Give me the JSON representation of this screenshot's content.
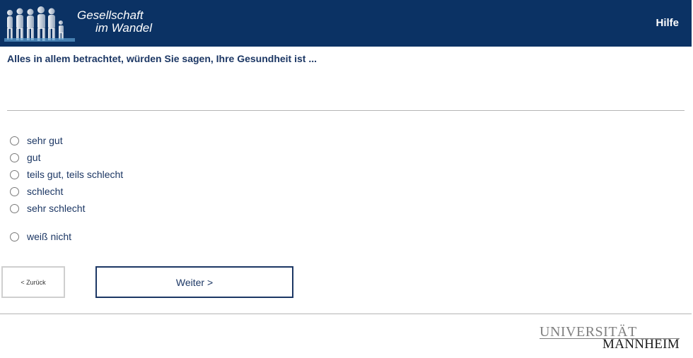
{
  "header": {
    "logo_line1": "Gesellschaft",
    "logo_line2": "im Wandel",
    "help_label": "Hilfe"
  },
  "question": {
    "text": "Alles in allem betrachtet, würden Sie sagen, Ihre Gesundheit ist ..."
  },
  "options": [
    {
      "label": "sehr gut",
      "selected": false
    },
    {
      "label": "gut",
      "selected": false
    },
    {
      "label": "teils gut, teils schlecht",
      "selected": false
    },
    {
      "label": "schlecht",
      "selected": false
    },
    {
      "label": "sehr schlecht",
      "selected": false
    },
    {
      "label": "weiß nicht",
      "selected": false
    }
  ],
  "nav": {
    "back_label": "< Zurück",
    "next_label": "Weiter >"
  },
  "footer": {
    "university_line1": "UNIVERSITÄT",
    "university_line2": "MANNHEIM"
  },
  "colors": {
    "header_bg": "#0b3264",
    "text_primary": "#1c3764",
    "divider": "#b5b5b5"
  }
}
